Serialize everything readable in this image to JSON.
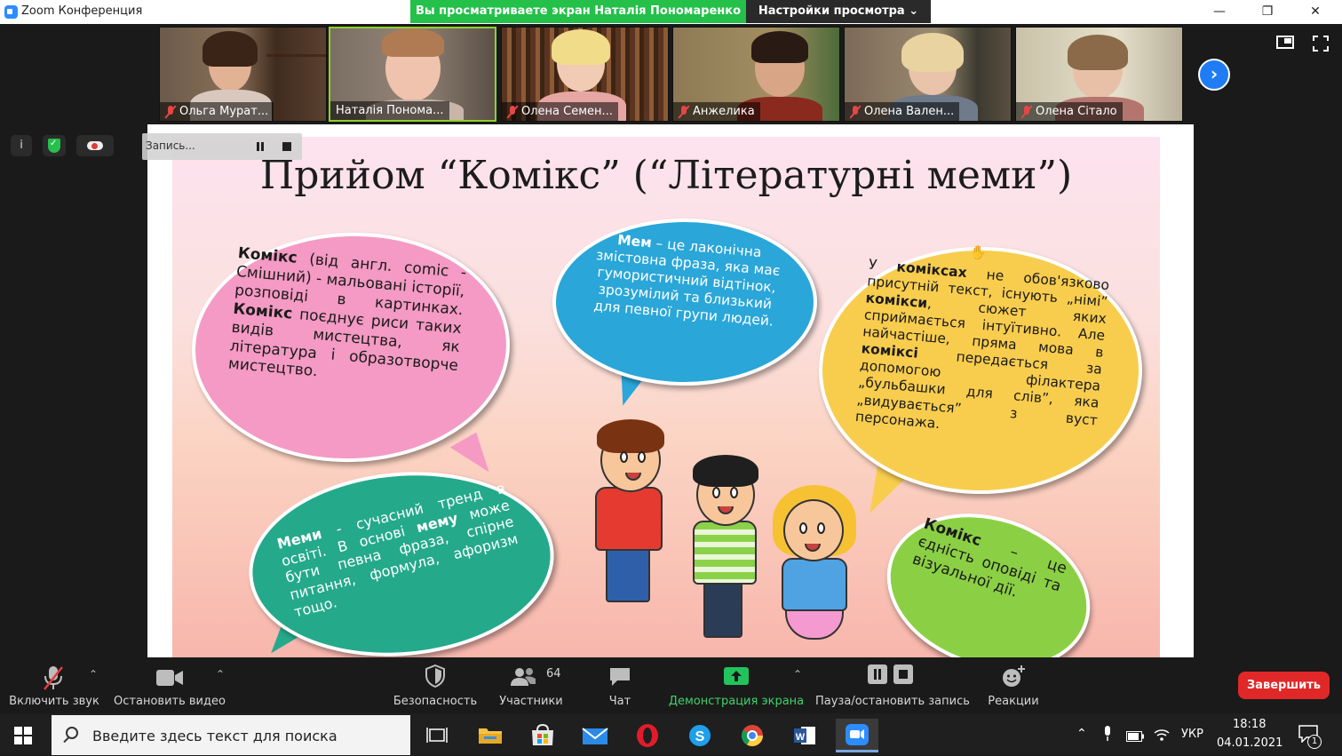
{
  "window": {
    "app_title": "Zoom Конференция",
    "share_banner": "Вы просматриваете экран Наталія Пономаренко",
    "view_options": "Настройки просмотра ⌄",
    "minimize": "—",
    "maximize": "❐",
    "close": "✕"
  },
  "participants": [
    {
      "name": "Ольга Мурат...",
      "muted": true
    },
    {
      "name": "Наталія Понома...",
      "muted": false,
      "active_speaker": true
    },
    {
      "name": "Олена Семен...",
      "muted": true
    },
    {
      "name": "Анжелика",
      "muted": true
    },
    {
      "name": "Олена Вален...",
      "muted": true
    },
    {
      "name": "Олена Сітало",
      "muted": true
    }
  ],
  "strip_next": "›",
  "status": {
    "info": "i",
    "recording_label": "Запись..."
  },
  "slide": {
    "title": "Прийом “Комікс” (“Літературні меми”)"
  },
  "toolbar": {
    "audio": "Включить звук",
    "video": "Остановить видео",
    "security": "Безопасность",
    "participants": "Участники",
    "participants_count": "64",
    "chat": "Чат",
    "share": "Демонстрация экрана",
    "record": "Пауза/остановить запись",
    "reactions": "Реакции",
    "end": "Завершить",
    "caret": "⌃"
  },
  "taskbar": {
    "search_placeholder": "Введите здесь текст для поиска",
    "language": "УКР",
    "time": "18:18",
    "date": "04.01.2021",
    "notifications": "1"
  },
  "colors": {
    "share_banner": "#24c04a",
    "end_button": "#e02828",
    "share_icon": "#22c35e",
    "accent_blue": "#1f7cf5"
  }
}
